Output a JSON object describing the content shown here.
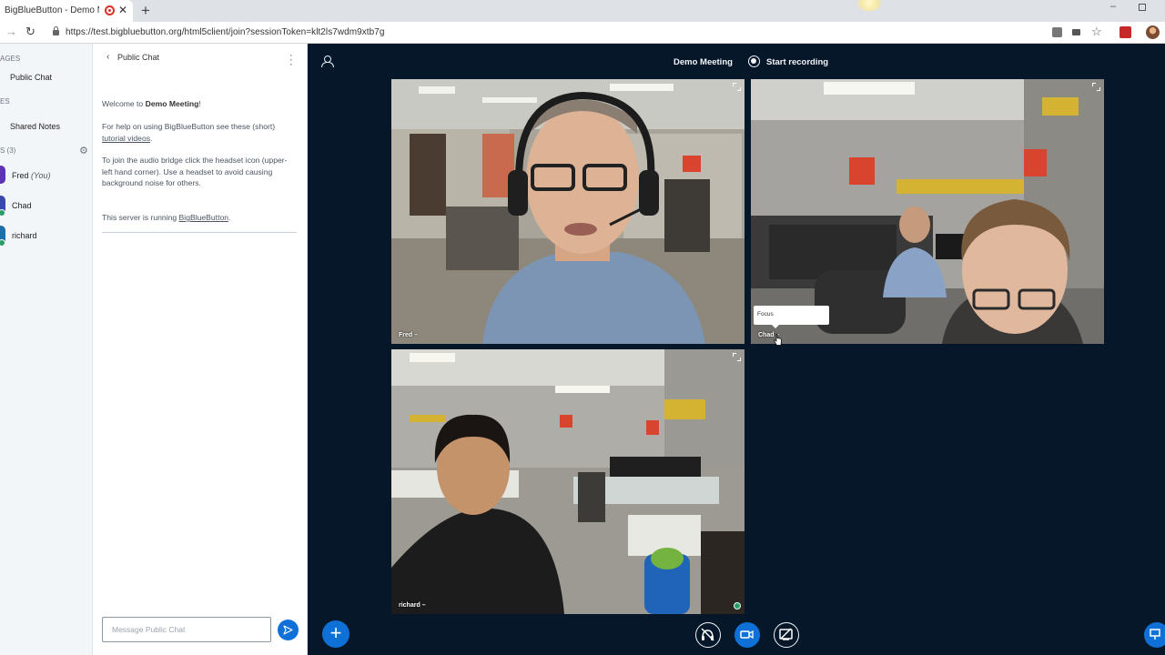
{
  "browser": {
    "tab_title": "BigBlueButton - Demo Meeting",
    "tab_close": "✕",
    "new_tab": "+",
    "url": "https://test.bigbluebutton.org/html5client/join?sessionToken=klt2ls7wdm9xtb7g",
    "back_icon": "arrow-right-icon",
    "reload_icon": "reload-icon",
    "star_icon": "☆"
  },
  "userlist": {
    "messages_header": "AGES",
    "public_chat": "Public Chat",
    "notes_header": "ES",
    "shared_notes": "Shared Notes",
    "users_header": "S (3)",
    "users": [
      {
        "name": "Fred",
        "you": "(You)",
        "color": "#5e35b1"
      },
      {
        "name": "Chad",
        "you": "",
        "color": "#3949ab"
      },
      {
        "name": "richard",
        "you": "",
        "color": "#1e6fa8"
      }
    ]
  },
  "chat": {
    "title": "Public Chat",
    "welcome_prefix": "Welcome to ",
    "welcome_meeting": "Demo Meeting",
    "welcome_suffix": "!",
    "help_text": "For help on using BigBlueButton see these (short) ",
    "help_link": "tutorial videos",
    "help_end": ".",
    "audio_text": "To join the audio bridge click the headset icon (upper-left hand corner). Use a headset to avoid causing background noise for others.",
    "server_text": "This server is running ",
    "server_link": "BigBlueButton",
    "server_end": ".",
    "input_placeholder": "Message Public Chat"
  },
  "meeting": {
    "title": "Demo Meeting",
    "record_label": "Start recording",
    "tooltip": "Focus",
    "videos": [
      {
        "name": "Fred –"
      },
      {
        "name": "Chad –"
      },
      {
        "name": "richard –"
      }
    ]
  },
  "colors": {
    "primary_blue": "#0f70d7",
    "main_bg": "#06172a",
    "mic_green": "#2b9e68"
  }
}
